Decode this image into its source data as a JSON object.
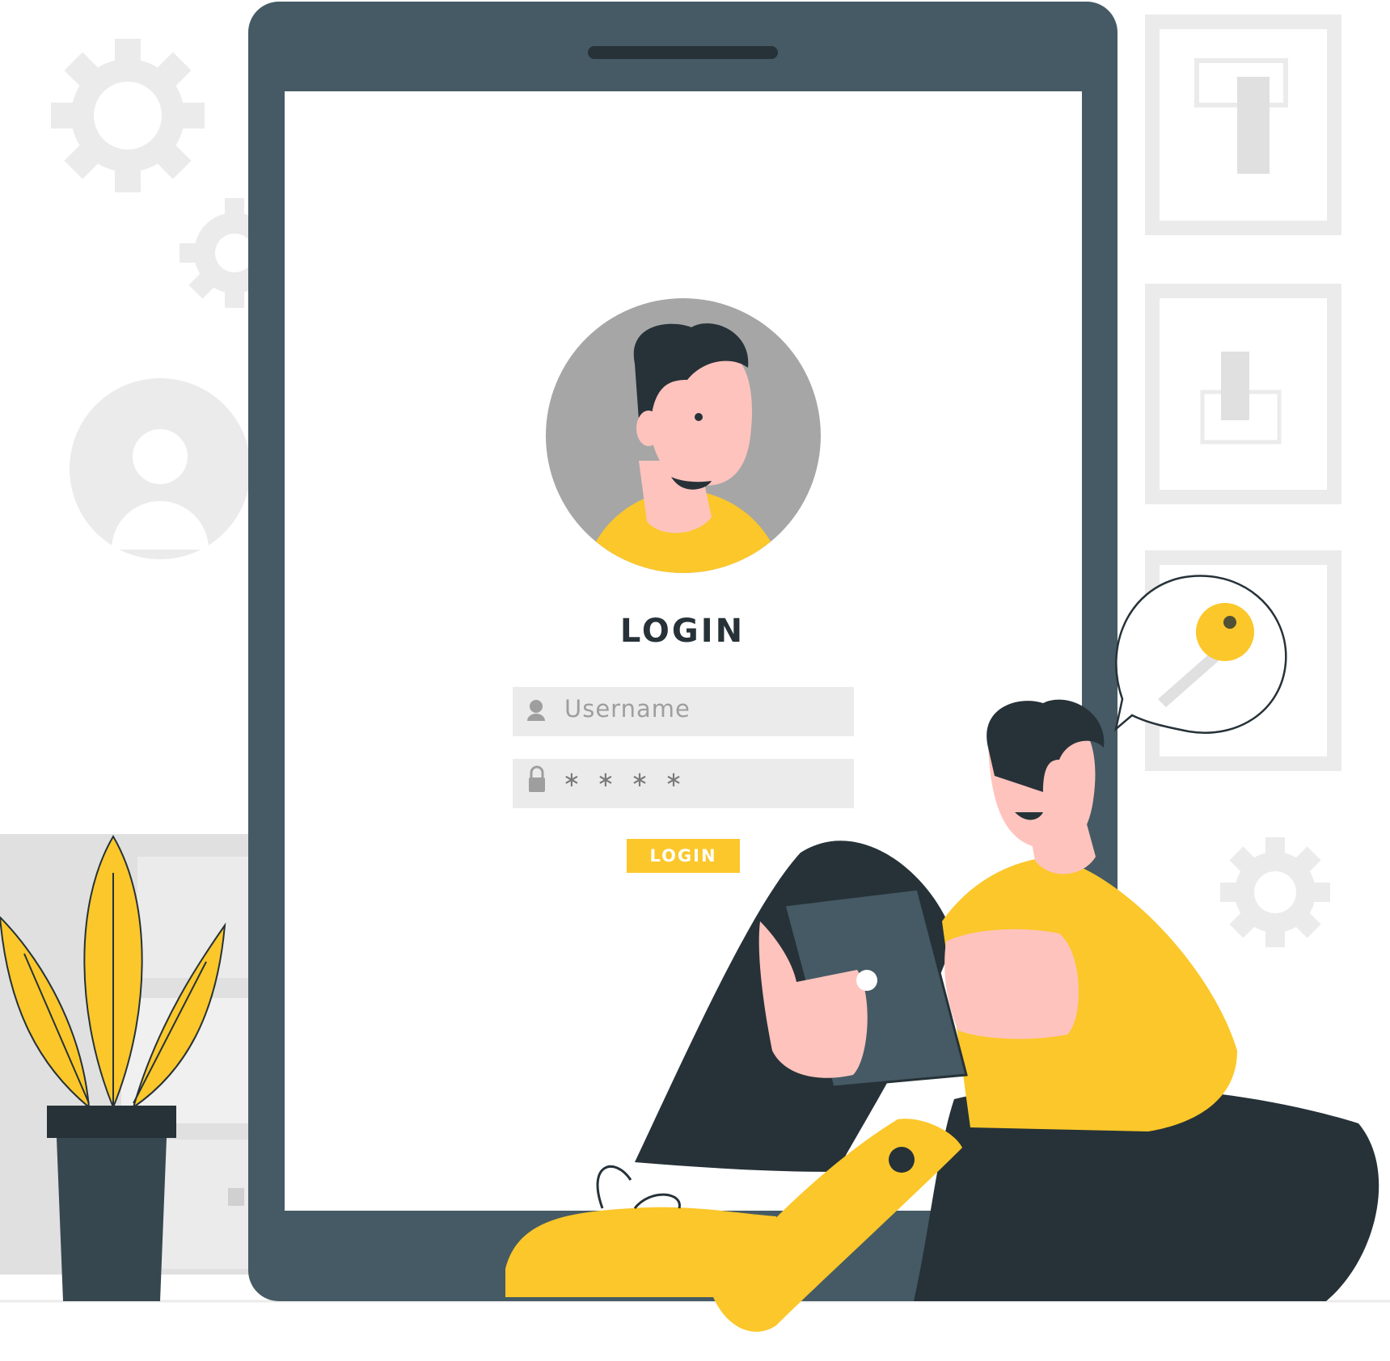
{
  "login": {
    "title": "LOGIN",
    "username_placeholder": "Username",
    "password_mask": "∗ ∗ ∗ ∗",
    "button_label": "LOGIN"
  },
  "colors": {
    "device": "#455a64",
    "accent": "#fbc72a",
    "dark": "#263238",
    "skin": "#ffc3bd",
    "light_gray": "#ebebeb",
    "avatar_bg": "#a6a6a6"
  },
  "icons": [
    "gear-icon",
    "user-icon",
    "lock-icon",
    "key-icon",
    "avatar"
  ]
}
